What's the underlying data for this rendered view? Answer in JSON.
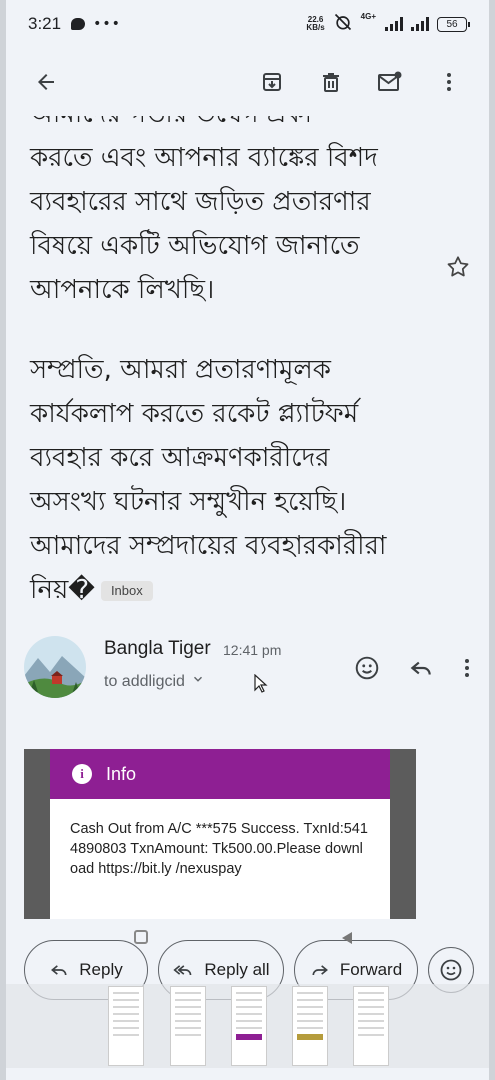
{
  "status_bar": {
    "time": "3:21",
    "speed_value": "22.6",
    "speed_unit": "KB/s",
    "network": "4G+",
    "battery": "56"
  },
  "icons": {
    "back": "arrow-back-icon",
    "archive": "archive-icon",
    "delete": "trash-icon",
    "mark_unread": "mail-unread-icon",
    "more": "more-vert-icon",
    "star": "star-outline-icon",
    "emoji": "emoji-icon",
    "reply": "reply-icon",
    "reply_all": "reply-all-icon",
    "forward": "forward-icon",
    "info": "info-icon"
  },
  "email": {
    "paragraph1_lines": [
      "আমাদের গভীর উদ্বেগ প্রকা",
      "করতে এবং আপনার ব্যাঙ্কের বিশদ",
      "ব্যবহারের সাথে জড়িত প্রতারণার",
      "বিষয়ে একটি অভিযোগ জানাতে",
      "আপনাকে লিখছি।"
    ],
    "paragraph2_lines": [
      "সম্প্রতি, আমরা প্রতারণামূলক",
      "কার্যকলাপ করতে রকেট প্ল্যাটফর্ম",
      "ব্যবহার করে আক্রমণকারীদের",
      "অসংখ্য ঘটনার সম্মুখীন হয়েছি।",
      "আমাদের সম্প্রদায়ের ব্যবহারকারীরা",
      "নিয়�"
    ],
    "label_chip": "Inbox"
  },
  "sender": {
    "name": "Bangla Tiger",
    "time": "12:41 pm",
    "to": "to addligcid"
  },
  "attachment": {
    "header": "Info",
    "message": "Cash Out from A/C ***575 Success. TxnId:5414890803 TxnAmount: Tk500.00.Please download https://bit.ly /nexuspay"
  },
  "buttons": {
    "reply": "Reply",
    "reply_all": "Reply all",
    "forward": "Forward"
  },
  "colors": {
    "background": "#f0f3f8",
    "attachment_header": "#8e1f93",
    "text": "#1f1f1f"
  }
}
